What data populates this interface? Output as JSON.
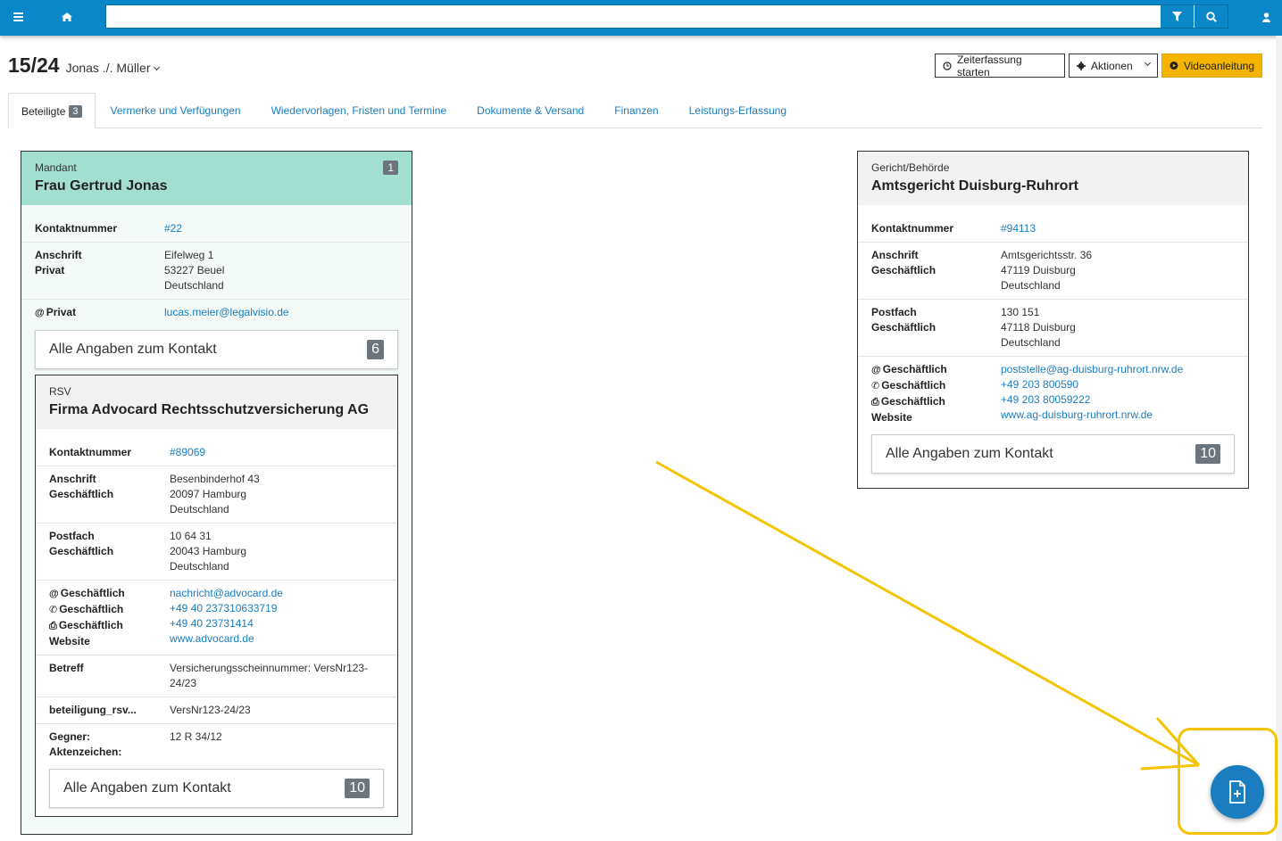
{
  "topbar": {
    "menu_icon": "bars-icon",
    "home_icon": "home-icon",
    "search_placeholder": "",
    "filter_icon": "filter-icon",
    "search_icon": "search-icon",
    "user_icon": "user-icon"
  },
  "header": {
    "case_number": "15/24",
    "case_name": "Jonas ./. Müller",
    "btn_zeiterfassung": "Zeiterfassung starten",
    "btn_aktionen": "Aktionen",
    "btn_video": "Videoanleitung"
  },
  "tabs": [
    {
      "label": "Beteiligte",
      "badge": "3"
    },
    {
      "label": "Vermerke und Verfügungen"
    },
    {
      "label": "Wiedervorlagen, Fristen und Termine"
    },
    {
      "label": "Dokumente & Versand"
    },
    {
      "label": "Finanzen"
    },
    {
      "label": "Leistungs-Erfassung"
    }
  ],
  "mandant": {
    "role": "Mandant",
    "name": "Frau Gertrud Jonas",
    "count": "1",
    "kontakt_label": "Kontaktnummer",
    "kontakt_value": "#22",
    "anschrift_label1": "Anschrift",
    "anschrift_label2": "Privat",
    "anschrift_l1": "Eifelweg 1",
    "anschrift_l2": "53227 Beuel",
    "anschrift_l3": "Deutschland",
    "email_label": "Privat",
    "email_value": "lucas.meier@legalvisio.de",
    "all_label": "Alle Angaben zum Kontakt",
    "all_count": "6"
  },
  "rsv": {
    "role": "RSV",
    "name": "Firma Advocard Rechtsschutzversicherung AG",
    "kontakt_label": "Kontaktnummer",
    "kontakt_value": "#89069",
    "anschrift_label1": "Anschrift",
    "anschrift_label2": "Geschäftlich",
    "anschrift_l1": "Besenbinderhof 43",
    "anschrift_l2": "20097 Hamburg",
    "anschrift_l3": "Deutschland",
    "postfach_label1": "Postfach",
    "postfach_label2": "Geschäftlich",
    "postfach_l1": "10 64 31",
    "postfach_l2": "20043 Hamburg",
    "postfach_l3": "Deutschland",
    "email_label": "Geschäftlich",
    "email_value": "nachricht@advocard.de",
    "phone_label": "Geschäftlich",
    "phone_value": "+49 40 237310633719",
    "fax_label": "Geschäftlich",
    "fax_value": "+49 40 23731414",
    "web_label": "Website",
    "web_value": "www.advocard.de",
    "betreff_label": "Betreff",
    "betreff_value": "Versicherungsscheinnummer: VersNr123-24/23",
    "beteiligung_label": "beteiligung_rsv...",
    "beteiligung_value": "VersNr123-24/23",
    "gegner_label1": "Gegner:",
    "gegner_label2": "Aktenzeichen:",
    "gegner_value": "12 R 34/12",
    "all_label": "Alle Angaben zum Kontakt",
    "all_count": "10"
  },
  "gericht": {
    "role": "Gericht/Behörde",
    "name": "Amtsgericht Duisburg-Ruhrort",
    "kontakt_label": "Kontaktnummer",
    "kontakt_value": "#94113",
    "anschrift_label1": "Anschrift",
    "anschrift_label2": "Geschäftlich",
    "anschrift_l1": "Amtsgerichtsstr. 36",
    "anschrift_l2": "47119 Duisburg",
    "anschrift_l3": "Deutschland",
    "postfach_label1": "Postfach",
    "postfach_label2": "Geschäftlich",
    "postfach_l1": "130 151",
    "postfach_l2": "47118 Duisburg",
    "postfach_l3": "Deutschland",
    "email_label": "Geschäftlich",
    "email_value": "poststelle@ag-duisburg-ruhrort.nrw.de",
    "phone_label": "Geschäftlich",
    "phone_value": "+49 203 800590",
    "fax_label": "Geschäftlich",
    "fax_value": "+49 203 80059222",
    "web_label": "Website",
    "web_value": "www.ag-duisburg-ruhrort.nrw.de",
    "all_label": "Alle Angaben zum Kontakt",
    "all_count": "10"
  },
  "fab": {
    "icon": "file-plus-icon"
  },
  "annotation_color": "#f5c400"
}
